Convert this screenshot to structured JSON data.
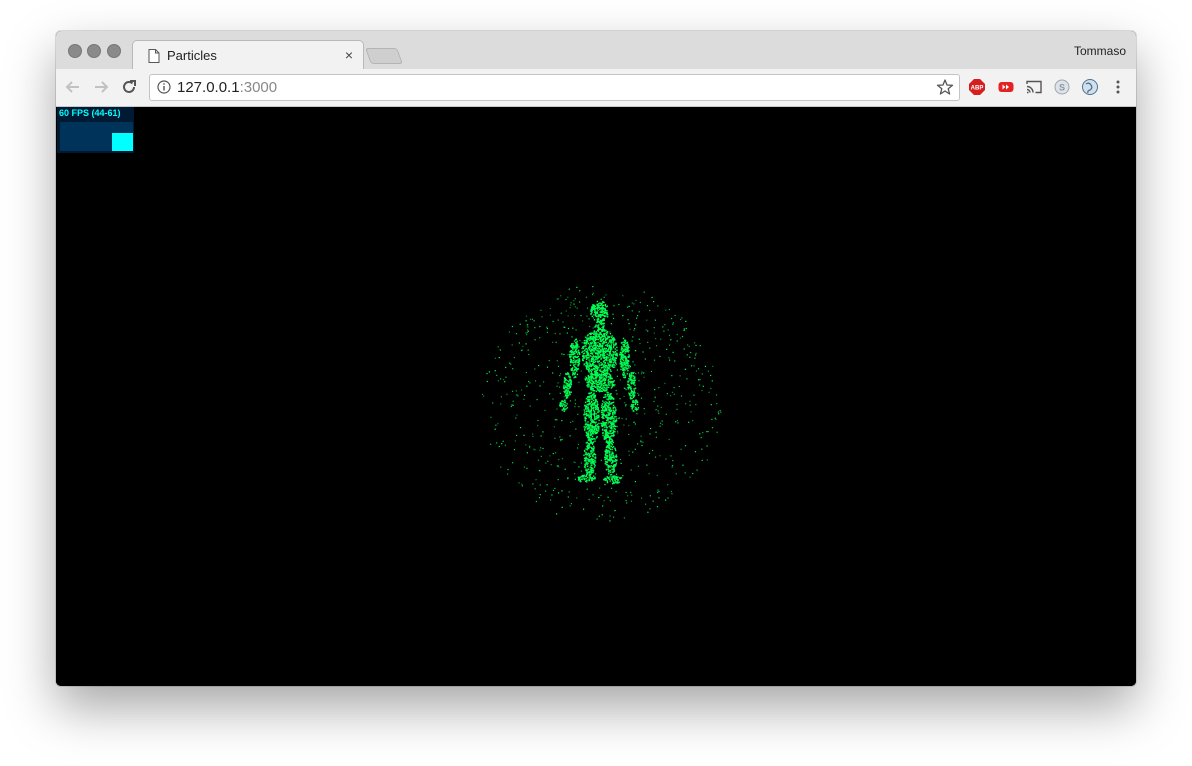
{
  "browser": {
    "tab_title": "Particles",
    "tab_close": "×",
    "profile_name": "Tommaso",
    "url_host": "127.0.0.1",
    "url_port": ":3000",
    "extensions": [
      "adblock-plus-icon",
      "youtube-icon",
      "cast-icon",
      "skype-icon",
      "globe-extension-icon"
    ]
  },
  "page": {
    "stats_label": "60 FPS (44-61)"
  },
  "colors": {
    "particles": "#00ff55",
    "stats_text": "#00ffff",
    "stats_bg": "#001a33"
  }
}
